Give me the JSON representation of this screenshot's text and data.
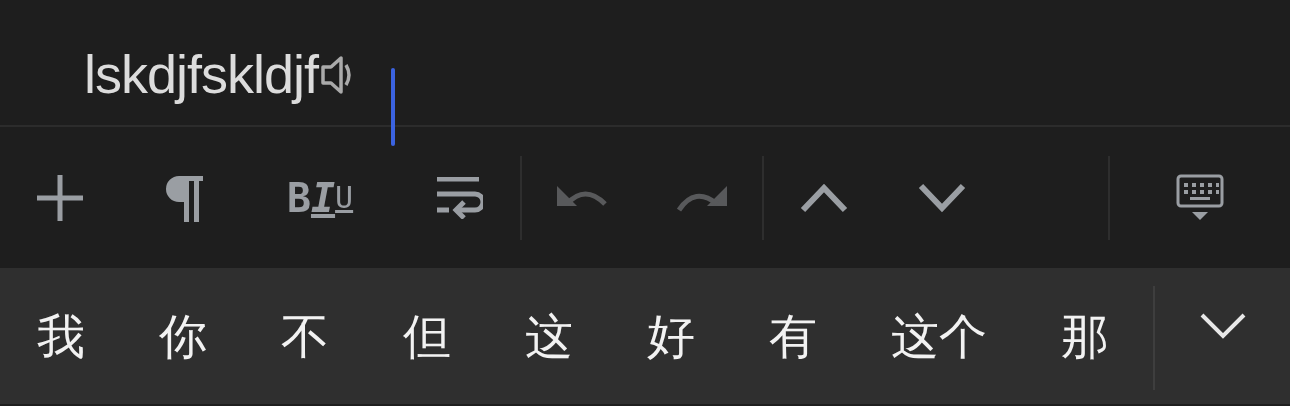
{
  "editor": {
    "text": "lskdjfskldjf"
  },
  "toolbar": {
    "buttons": [
      {
        "disabled": false
      },
      {
        "disabled": false
      },
      {
        "letters": [
          "B",
          "I",
          "U"
        ],
        "disabled": false
      },
      {
        "disabled": false
      },
      {
        "disabled": true
      },
      {
        "disabled": true
      },
      {
        "disabled": false
      },
      {
        "disabled": false
      },
      {
        "disabled": false
      }
    ]
  },
  "candidates": [
    "我",
    "你",
    "不",
    "但",
    "这",
    "好",
    "有",
    "这个",
    "那"
  ]
}
